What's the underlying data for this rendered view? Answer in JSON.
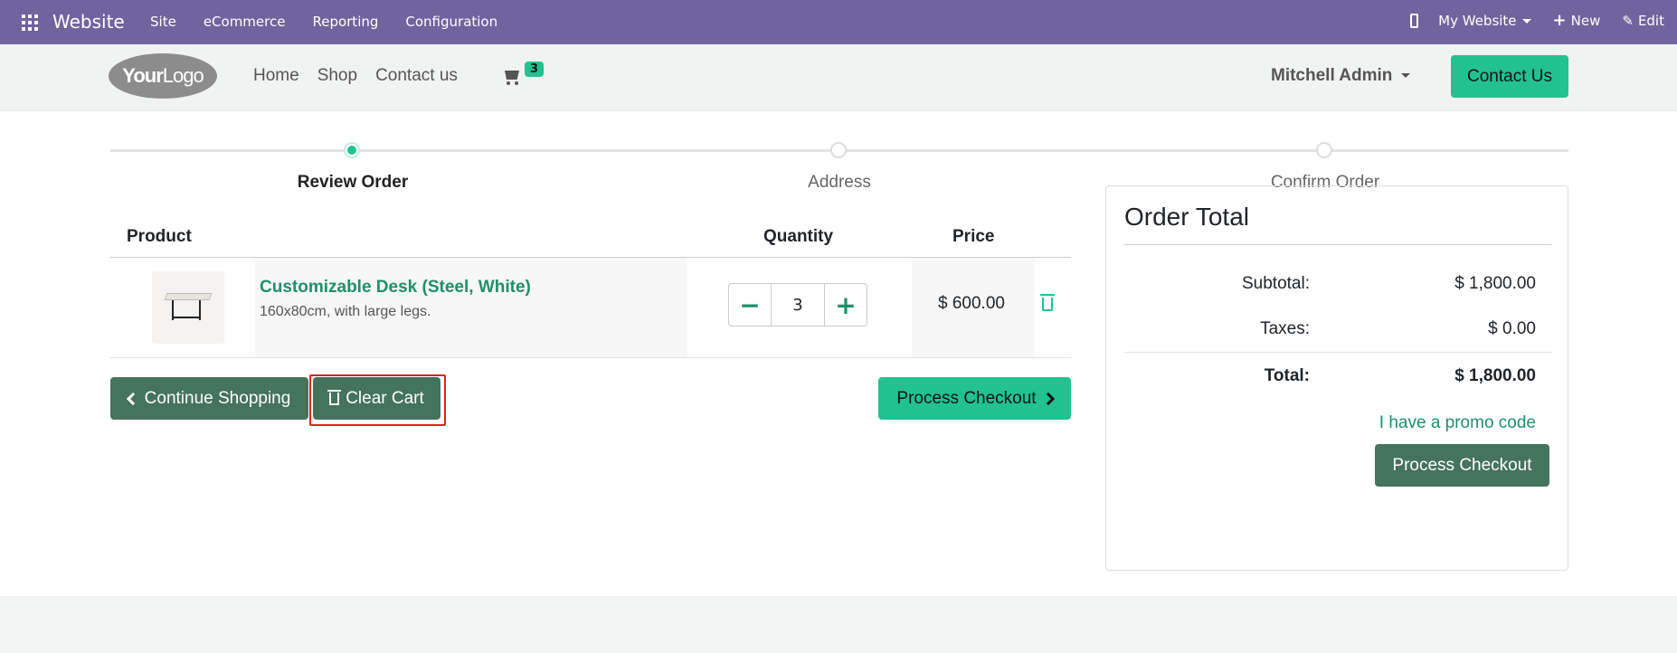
{
  "topbar": {
    "app_name": "Website",
    "menu": [
      "Site",
      "eCommerce",
      "Reporting",
      "Configuration"
    ],
    "website_selector": "My Website",
    "new_label": "New",
    "edit_label": "Edit"
  },
  "header": {
    "logo_bold": "Your",
    "logo_thin": "Logo",
    "nav": [
      "Home",
      "Shop",
      "Contact us"
    ],
    "cart_count": "3",
    "user_name": "Mitchell Admin",
    "contact_button": "Contact Us"
  },
  "steps": [
    "Review Order",
    "Address",
    "Confirm Order"
  ],
  "cart": {
    "col_product": "Product",
    "col_quantity": "Quantity",
    "col_price": "Price",
    "item": {
      "name": "Customizable Desk (Steel, White)",
      "description": "160x80cm, with large legs.",
      "quantity": "3",
      "price": "$ 600.00"
    },
    "continue_label": "Continue Shopping",
    "clear_label": "Clear Cart",
    "checkout_label": "Process Checkout"
  },
  "summary": {
    "title": "Order Total",
    "subtotal_label": "Subtotal:",
    "subtotal_value": "$ 1,800.00",
    "taxes_label": "Taxes:",
    "taxes_value": "$ 0.00",
    "total_label": "Total:",
    "total_value": "$ 1,800.00",
    "promo_label": "I have a promo code",
    "checkout_label": "Process Checkout"
  },
  "colors": {
    "topbar": "#71639e",
    "accent": "#21c290",
    "dark_button": "#44735e",
    "link": "#1f8f6a",
    "highlight": "#e02020"
  }
}
